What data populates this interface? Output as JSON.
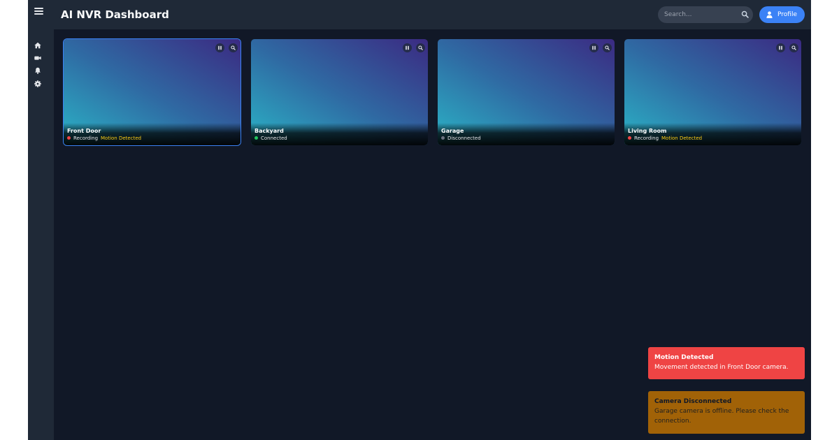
{
  "header": {
    "title": "AI NVR Dashboard",
    "menu_icon": "hamburger-menu-icon",
    "search_placeholder": "Search...",
    "profile_label": "Profile"
  },
  "sidebar": {
    "items": [
      {
        "name": "home",
        "icon": "home-icon"
      },
      {
        "name": "cameras",
        "icon": "video-camera-icon"
      },
      {
        "name": "alerts",
        "icon": "bell-icon"
      },
      {
        "name": "settings",
        "icon": "gear-icon"
      }
    ]
  },
  "cameras": [
    {
      "name": "Front Door",
      "status": "Recording",
      "status_color": "#ef4444",
      "motion": "Motion Detected",
      "selected": true
    },
    {
      "name": "Backyard",
      "status": "Connected",
      "status_color": "#22c55e",
      "motion": "",
      "selected": false
    },
    {
      "name": "Garage",
      "status": "Disconnected",
      "status_color": "#6b7280",
      "motion": "",
      "selected": false
    },
    {
      "name": "Living Room",
      "status": "Recording",
      "status_color": "#ef4444",
      "motion": "Motion Detected",
      "selected": false
    }
  ],
  "notifications": [
    {
      "title": "Motion Detected",
      "message": "Movement detected in Front Door camera.",
      "color": "#ef4444"
    },
    {
      "title": "Camera Disconnected",
      "message": "Garage camera is offline. Please check the connection.",
      "color": "#a16207"
    }
  ],
  "colors": {
    "accent": "#3b82f6",
    "background": "#111827",
    "panel": "#1f2937",
    "motion_text": "#facc15"
  }
}
